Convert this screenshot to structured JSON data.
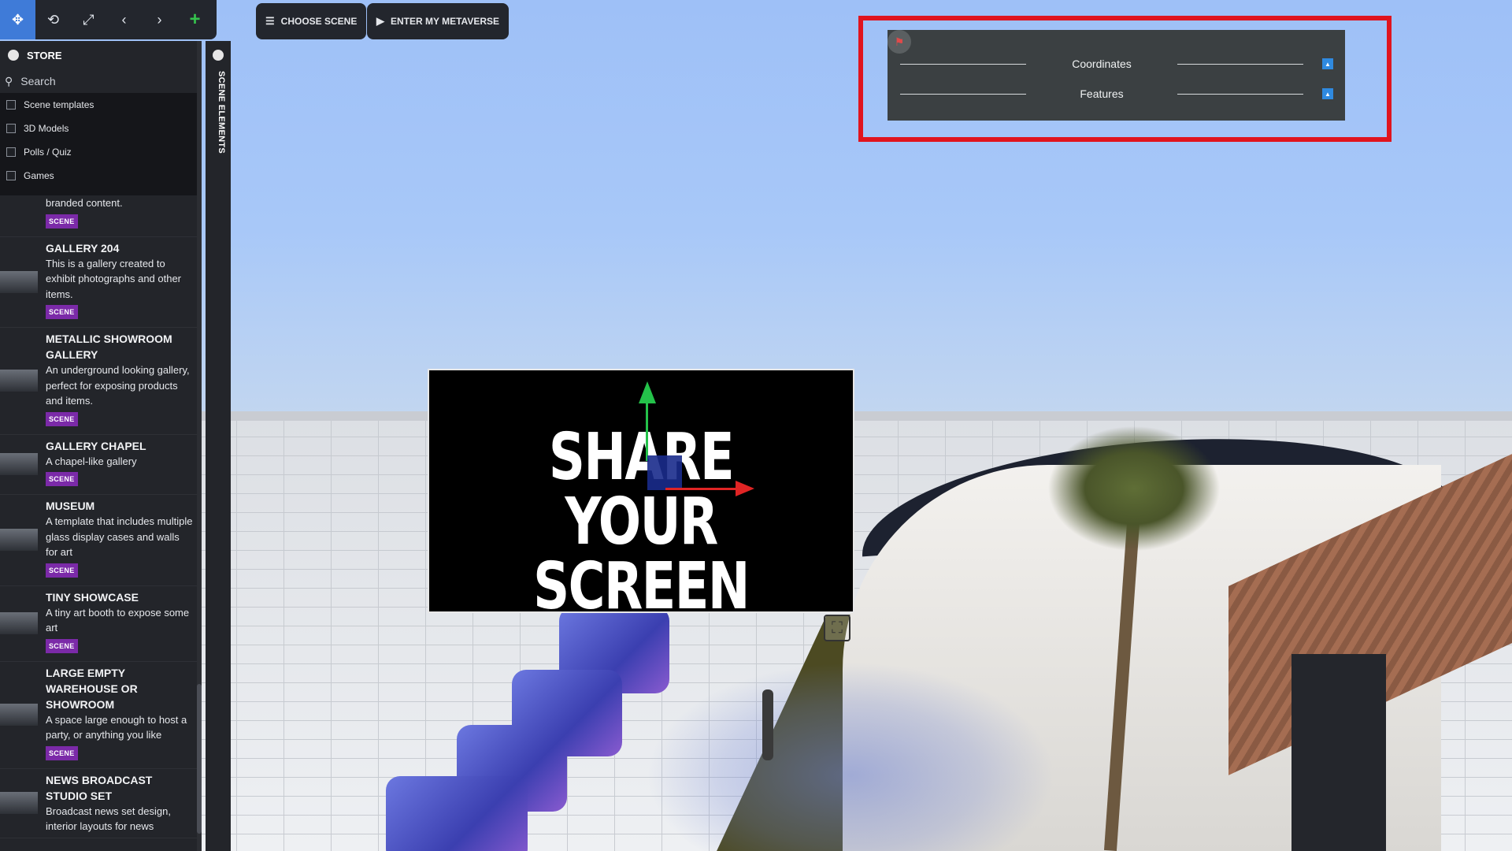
{
  "toolbar": {
    "tools": [
      {
        "name": "move-tool",
        "glyph": "✥",
        "active": true
      },
      {
        "name": "rotate-tool",
        "glyph": "⟲",
        "active": false
      },
      {
        "name": "scale-tool",
        "glyph": "⤢",
        "active": false
      },
      {
        "name": "undo-tool",
        "glyph": "‹",
        "active": false
      },
      {
        "name": "redo-tool",
        "glyph": "›",
        "active": false
      },
      {
        "name": "add-tool",
        "glyph": "+",
        "active": false
      }
    ],
    "choose_scene_label": "CHOOSE SCENE",
    "enter_metaverse_label": "ENTER MY METAVERSE"
  },
  "store": {
    "title": "STORE",
    "search_placeholder": "Search",
    "filters": [
      {
        "label": "Scene templates"
      },
      {
        "label": "3D Models"
      },
      {
        "label": "Polls / Quiz"
      },
      {
        "label": "Games"
      }
    ],
    "items": [
      {
        "title": "",
        "desc": "branded content.",
        "badge": "SCENE"
      },
      {
        "title": "GALLERY 204",
        "desc": "This is a gallery created to exhibit photographs and other items.",
        "badge": "SCENE"
      },
      {
        "title": "METALLIC SHOWROOM GALLERY",
        "desc": "An underground looking gallery, perfect for exposing products and items.",
        "badge": "SCENE"
      },
      {
        "title": "GALLERY CHAPEL",
        "desc": "A chapel-like gallery",
        "badge": "SCENE"
      },
      {
        "title": "MUSEUM",
        "desc": "A template that includes multiple glass display cases and walls for art",
        "badge": "SCENE"
      },
      {
        "title": "TINY SHOWCASE",
        "desc": "A tiny art booth to expose some art",
        "badge": "SCENE"
      },
      {
        "title": "LARGE EMPTY WAREHOUSE OR SHOWROOM",
        "desc": "A space large enough to host a party, or anything you like",
        "badge": "SCENE"
      },
      {
        "title": "NEWS BROADCAST STUDIO SET",
        "desc": "Broadcast news set design, interior layouts for news",
        "badge": ""
      }
    ]
  },
  "scene_elements": {
    "label": "SCENE ELEMENTS"
  },
  "properties_panel": {
    "rows": [
      {
        "label": "Coordinates"
      },
      {
        "label": "Features"
      }
    ]
  },
  "scene": {
    "board_line1": "SHARE YOUR",
    "board_line2": "SCREEN"
  },
  "colors": {
    "accent": "#3f7bd8",
    "badge": "#7b2aa8",
    "highlight": "#e0141e",
    "panel": "#3b4042"
  }
}
